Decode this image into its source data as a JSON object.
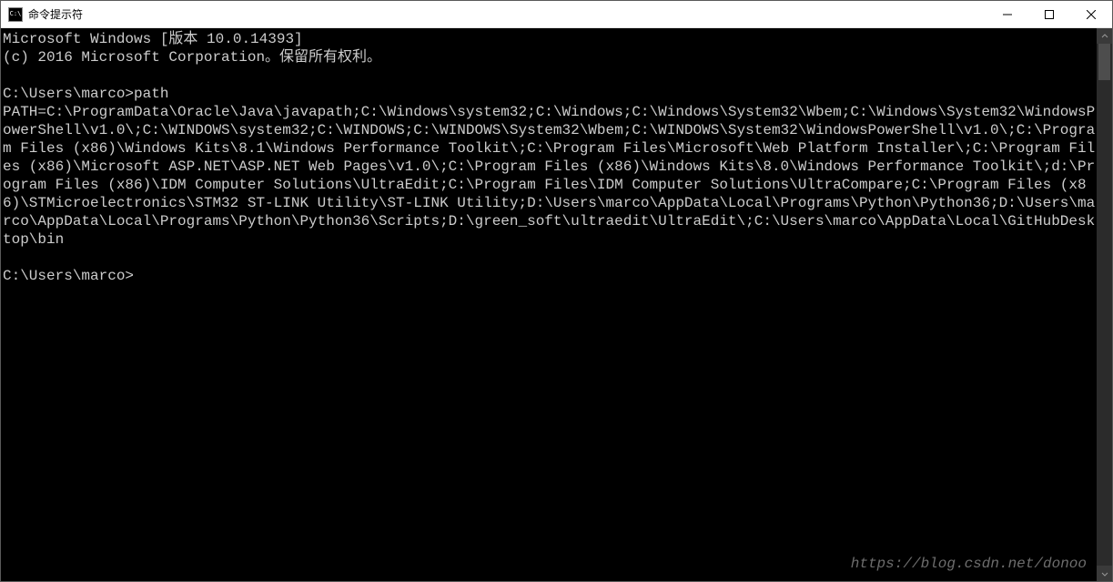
{
  "window": {
    "title": "命令提示符"
  },
  "terminal": {
    "header1": "Microsoft Windows [版本 10.0.14393]",
    "header2": "(c) 2016 Microsoft Corporation。保留所有权利。",
    "prompt1_prefix": "C:\\Users\\marco>",
    "prompt1_cmd": "path",
    "path_output": "PATH=C:\\ProgramData\\Oracle\\Java\\javapath;C:\\Windows\\system32;C:\\Windows;C:\\Windows\\System32\\Wbem;C:\\Windows\\System32\\WindowsPowerShell\\v1.0\\;C:\\WINDOWS\\system32;C:\\WINDOWS;C:\\WINDOWS\\System32\\Wbem;C:\\WINDOWS\\System32\\WindowsPowerShell\\v1.0\\;C:\\Program Files (x86)\\Windows Kits\\8.1\\Windows Performance Toolkit\\;C:\\Program Files\\Microsoft\\Web Platform Installer\\;C:\\Program Files (x86)\\Microsoft ASP.NET\\ASP.NET Web Pages\\v1.0\\;C:\\Program Files (x86)\\Windows Kits\\8.0\\Windows Performance Toolkit\\;d:\\Program Files (x86)\\IDM Computer Solutions\\UltraEdit;C:\\Program Files\\IDM Computer Solutions\\UltraCompare;C:\\Program Files (x86)\\STMicroelectronics\\STM32 ST-LINK Utility\\ST-LINK Utility;D:\\Users\\marco\\AppData\\Local\\Programs\\Python\\Python36;D:\\Users\\marco\\AppData\\Local\\Programs\\Python\\Python36\\Scripts;D:\\green_soft\\ultraedit\\UltraEdit\\;C:\\Users\\marco\\AppData\\Local\\GitHubDesktop\\bin",
    "prompt2_prefix": "C:\\Users\\marco>"
  },
  "watermark": "https://blog.csdn.net/donoo"
}
